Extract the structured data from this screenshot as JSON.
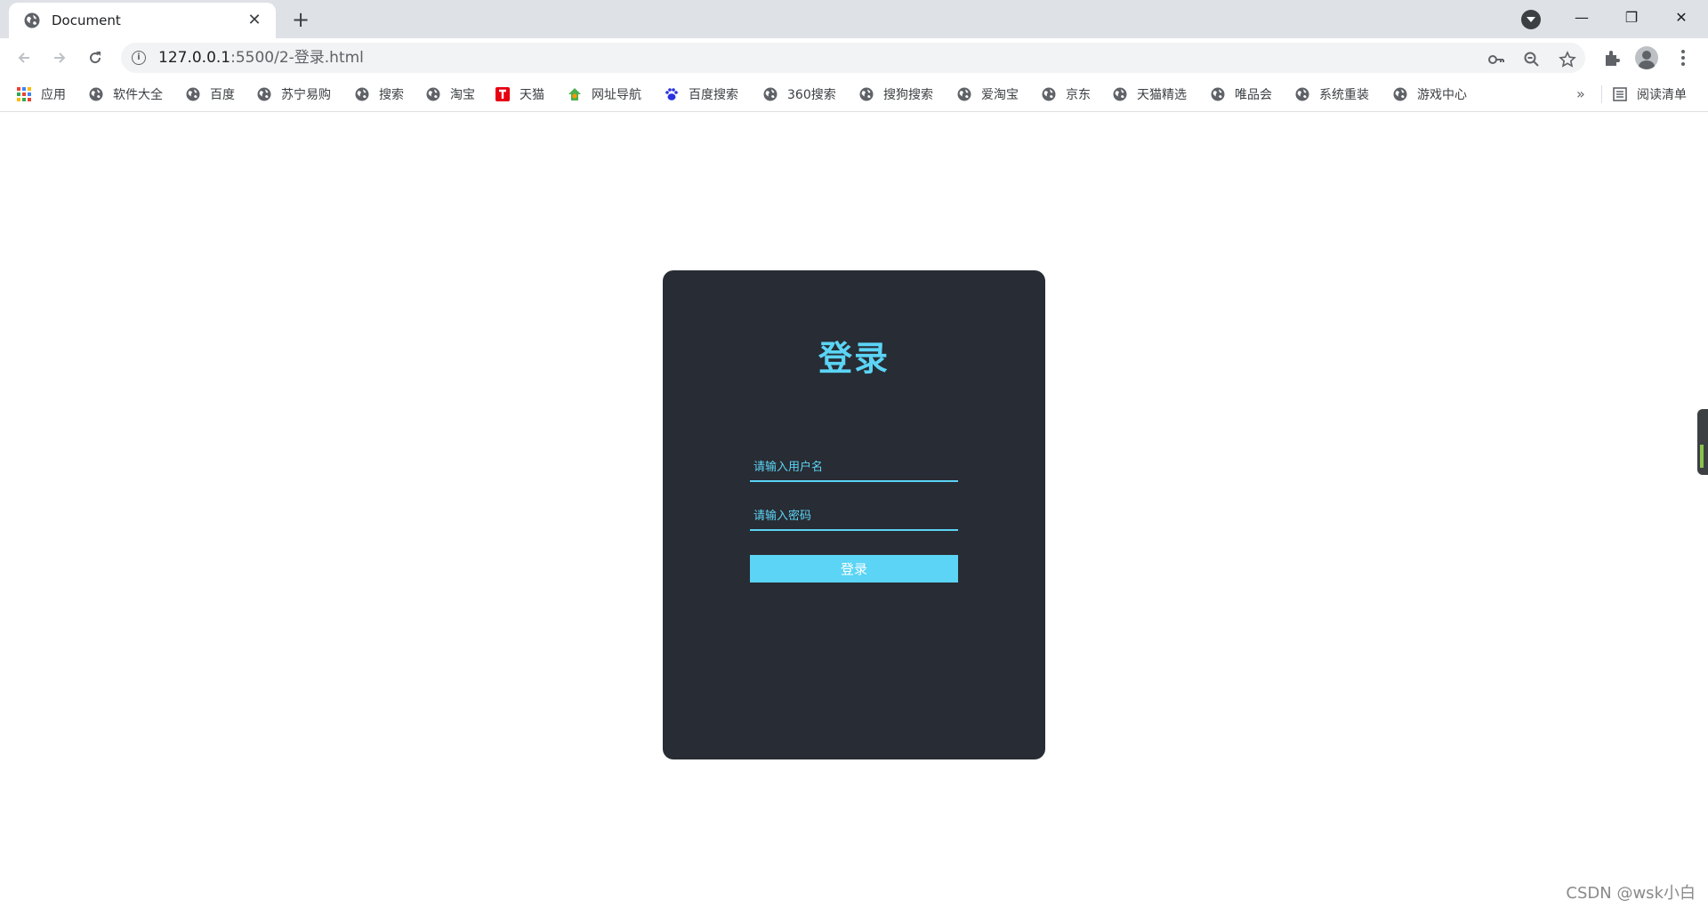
{
  "browser": {
    "tab": {
      "title": "Document",
      "favicon": "globe-icon",
      "close": "✕"
    },
    "new_tab": "+",
    "window_controls": {
      "minimize": "—",
      "maximize": "❐",
      "close": "✕"
    },
    "address": {
      "host": "127.0.0.1",
      "path": ":5500/2-登录.html"
    }
  },
  "bookmarks": {
    "apps_label": "应用",
    "items": [
      {
        "label": "软件大全",
        "icon": "globe-icon"
      },
      {
        "label": "百度",
        "icon": "globe-icon"
      },
      {
        "label": "苏宁易购",
        "icon": "globe-icon"
      },
      {
        "label": "搜索",
        "icon": "globe-icon"
      },
      {
        "label": "淘宝",
        "icon": "globe-icon"
      },
      {
        "label": "天猫",
        "icon": "tmall-icon"
      },
      {
        "label": "网址导航",
        "icon": "nav-icon"
      },
      {
        "label": "百度搜索",
        "icon": "baidu-paw-icon"
      },
      {
        "label": "360搜索",
        "icon": "globe-icon"
      },
      {
        "label": "搜狗搜索",
        "icon": "globe-icon"
      },
      {
        "label": "爱淘宝",
        "icon": "globe-icon"
      },
      {
        "label": "京东",
        "icon": "globe-icon"
      },
      {
        "label": "天猫精选",
        "icon": "globe-icon"
      },
      {
        "label": "唯品会",
        "icon": "globe-icon"
      },
      {
        "label": "系统重装",
        "icon": "globe-icon"
      },
      {
        "label": "游戏中心",
        "icon": "globe-icon"
      }
    ],
    "more": "»",
    "reading_list": "阅读清单"
  },
  "login": {
    "title": "登录",
    "username_placeholder": "请输入用户名",
    "password_placeholder": "请输入密码",
    "submit_label": "登录"
  },
  "watermark": "CSDN @wsk小白",
  "colors": {
    "accent": "#5bd4f5",
    "card": "#282c34",
    "chrome": "#dee1e6"
  }
}
